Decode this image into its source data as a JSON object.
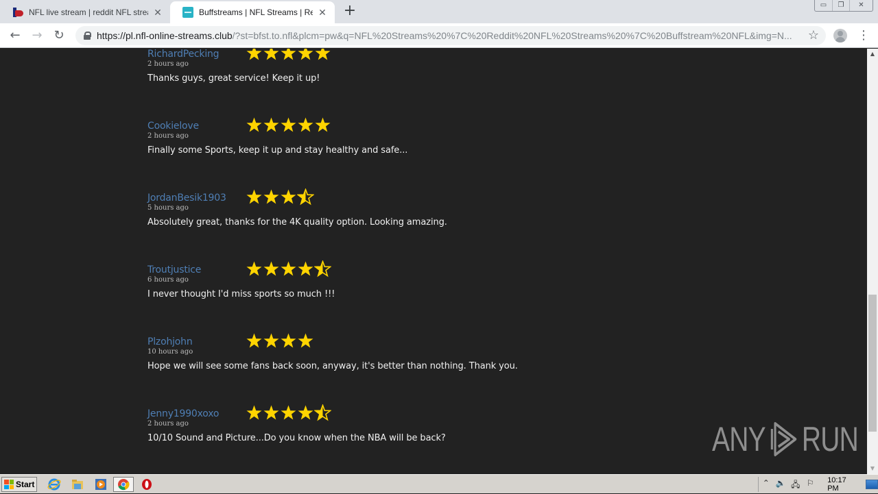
{
  "browser": {
    "tabs": [
      {
        "title": "NFL live stream | reddit NFL streams",
        "favicon": "nfl-site-icon",
        "active": false
      },
      {
        "title": "Buffstreams | NFL Streams | Reddit NFL",
        "favicon": "buffstreams-icon",
        "active": true
      }
    ],
    "new_tab_label": "+",
    "tab_close_glyph": "✕",
    "window_controls": {
      "minimize": "▭",
      "restore": "❐",
      "close": "✕"
    },
    "url_host": "https://pl.nfl-online-streams.club",
    "url_rest": "/?st=bfst.to.nfl&plcm=pw&q=NFL%20Streams%20%7C%20Reddit%20NFL%20Streams%20%7C%20Buffstream%20NFL&img=N...",
    "nav": {
      "back": "←",
      "forward": "→",
      "reload": "↻"
    },
    "bookmark_glyph": "☆",
    "menu_glyph": "⋮"
  },
  "reviews": [
    {
      "name": "RichardPecking",
      "time": "2 hours ago",
      "rating": 5,
      "text": "Thanks guys, great service! Keep it up!"
    },
    {
      "name": "Cookielove",
      "time": "2 hours ago",
      "rating": 5,
      "text": "Finally some Sports, keep it up and stay healthy and safe..."
    },
    {
      "name": "JordanBesik1903",
      "time": "5 hours ago",
      "rating": 3.5,
      "text": "Absolutely great, thanks for the 4K quality option. Looking amazing."
    },
    {
      "name": "Troutjustice",
      "time": "6 hours ago",
      "rating": 4.5,
      "text": "I never thought I'd miss sports so much !!!"
    },
    {
      "name": "Plzohjohn",
      "time": "10 hours ago",
      "rating": 4,
      "text": "Hope we will see some fans back soon, anyway, it's better than nothing. Thank you."
    },
    {
      "name": "Jenny1990xoxo",
      "time": "2 hours ago",
      "rating": 4.5,
      "text": "10/10 Sound and Picture...Do you know when the NBA will be back?"
    }
  ],
  "colors": {
    "star": "#ffd400",
    "name_link": "#4f7fb5",
    "page_bg": "#222222"
  },
  "watermark": {
    "left": "ANY",
    "right": "RUN"
  },
  "scrollbar": {
    "position_fraction": 0.78
  },
  "taskbar": {
    "start_label": "Start",
    "apps": [
      "internet-explorer-icon",
      "file-explorer-icon",
      "media-player-icon",
      "chrome-icon",
      "opera-icon"
    ],
    "tray": {
      "chevron": "⌃",
      "volume": "🔈",
      "network": "🖧",
      "flag": "⚐"
    },
    "clock": "10:17 PM"
  }
}
